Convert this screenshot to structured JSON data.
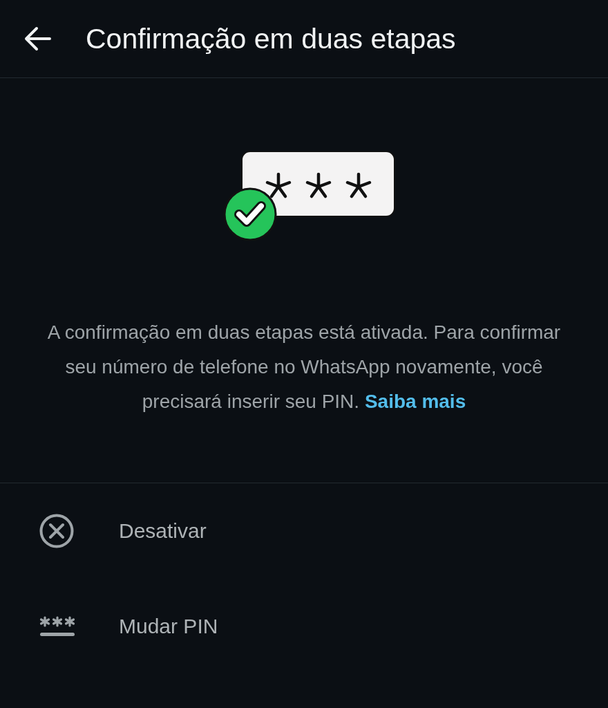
{
  "header": {
    "title": "Confirmação em duas etapas"
  },
  "info": {
    "description": "A confirmação em duas etapas está ativada. Para confirmar seu número de telefone no WhatsApp novamente, você precisará inserir seu PIN.",
    "link": "Saiba mais"
  },
  "options": [
    {
      "kind": "disable",
      "label": "Desativar"
    },
    {
      "kind": "change_pin",
      "label": "Mudar PIN"
    }
  ]
}
